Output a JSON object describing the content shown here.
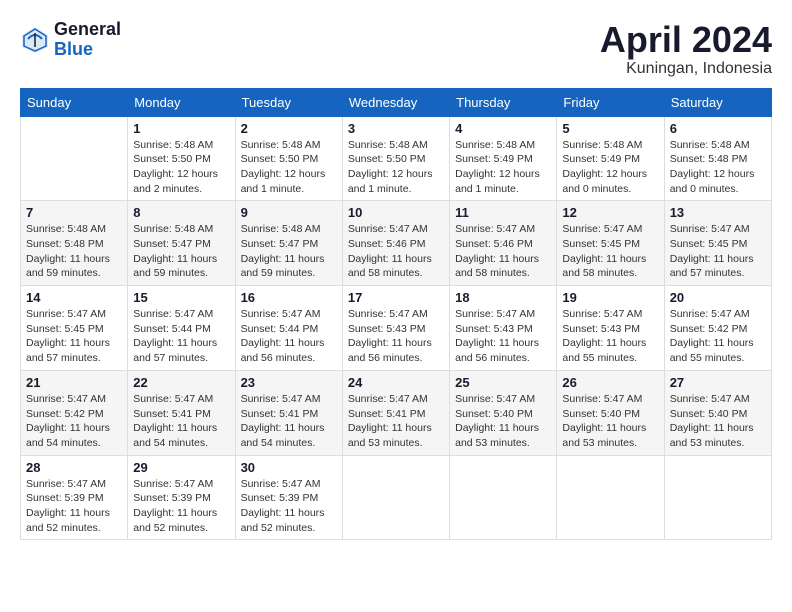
{
  "header": {
    "logo_general": "General",
    "logo_blue": "Blue",
    "month_title": "April 2024",
    "location": "Kuningan, Indonesia"
  },
  "days_of_week": [
    "Sunday",
    "Monday",
    "Tuesday",
    "Wednesday",
    "Thursday",
    "Friday",
    "Saturday"
  ],
  "weeks": [
    [
      {
        "day": "",
        "empty": true
      },
      {
        "day": "1",
        "sunrise": "Sunrise: 5:48 AM",
        "sunset": "Sunset: 5:50 PM",
        "daylight": "Daylight: 12 hours and 2 minutes."
      },
      {
        "day": "2",
        "sunrise": "Sunrise: 5:48 AM",
        "sunset": "Sunset: 5:50 PM",
        "daylight": "Daylight: 12 hours and 1 minute."
      },
      {
        "day": "3",
        "sunrise": "Sunrise: 5:48 AM",
        "sunset": "Sunset: 5:50 PM",
        "daylight": "Daylight: 12 hours and 1 minute."
      },
      {
        "day": "4",
        "sunrise": "Sunrise: 5:48 AM",
        "sunset": "Sunset: 5:49 PM",
        "daylight": "Daylight: 12 hours and 1 minute."
      },
      {
        "day": "5",
        "sunrise": "Sunrise: 5:48 AM",
        "sunset": "Sunset: 5:49 PM",
        "daylight": "Daylight: 12 hours and 0 minutes."
      },
      {
        "day": "6",
        "sunrise": "Sunrise: 5:48 AM",
        "sunset": "Sunset: 5:48 PM",
        "daylight": "Daylight: 12 hours and 0 minutes."
      }
    ],
    [
      {
        "day": "7",
        "sunrise": "Sunrise: 5:48 AM",
        "sunset": "Sunset: 5:48 PM",
        "daylight": "Daylight: 11 hours and 59 minutes."
      },
      {
        "day": "8",
        "sunrise": "Sunrise: 5:48 AM",
        "sunset": "Sunset: 5:47 PM",
        "daylight": "Daylight: 11 hours and 59 minutes."
      },
      {
        "day": "9",
        "sunrise": "Sunrise: 5:48 AM",
        "sunset": "Sunset: 5:47 PM",
        "daylight": "Daylight: 11 hours and 59 minutes."
      },
      {
        "day": "10",
        "sunrise": "Sunrise: 5:47 AM",
        "sunset": "Sunset: 5:46 PM",
        "daylight": "Daylight: 11 hours and 58 minutes."
      },
      {
        "day": "11",
        "sunrise": "Sunrise: 5:47 AM",
        "sunset": "Sunset: 5:46 PM",
        "daylight": "Daylight: 11 hours and 58 minutes."
      },
      {
        "day": "12",
        "sunrise": "Sunrise: 5:47 AM",
        "sunset": "Sunset: 5:45 PM",
        "daylight": "Daylight: 11 hours and 58 minutes."
      },
      {
        "day": "13",
        "sunrise": "Sunrise: 5:47 AM",
        "sunset": "Sunset: 5:45 PM",
        "daylight": "Daylight: 11 hours and 57 minutes."
      }
    ],
    [
      {
        "day": "14",
        "sunrise": "Sunrise: 5:47 AM",
        "sunset": "Sunset: 5:45 PM",
        "daylight": "Daylight: 11 hours and 57 minutes."
      },
      {
        "day": "15",
        "sunrise": "Sunrise: 5:47 AM",
        "sunset": "Sunset: 5:44 PM",
        "daylight": "Daylight: 11 hours and 57 minutes."
      },
      {
        "day": "16",
        "sunrise": "Sunrise: 5:47 AM",
        "sunset": "Sunset: 5:44 PM",
        "daylight": "Daylight: 11 hours and 56 minutes."
      },
      {
        "day": "17",
        "sunrise": "Sunrise: 5:47 AM",
        "sunset": "Sunset: 5:43 PM",
        "daylight": "Daylight: 11 hours and 56 minutes."
      },
      {
        "day": "18",
        "sunrise": "Sunrise: 5:47 AM",
        "sunset": "Sunset: 5:43 PM",
        "daylight": "Daylight: 11 hours and 56 minutes."
      },
      {
        "day": "19",
        "sunrise": "Sunrise: 5:47 AM",
        "sunset": "Sunset: 5:43 PM",
        "daylight": "Daylight: 11 hours and 55 minutes."
      },
      {
        "day": "20",
        "sunrise": "Sunrise: 5:47 AM",
        "sunset": "Sunset: 5:42 PM",
        "daylight": "Daylight: 11 hours and 55 minutes."
      }
    ],
    [
      {
        "day": "21",
        "sunrise": "Sunrise: 5:47 AM",
        "sunset": "Sunset: 5:42 PM",
        "daylight": "Daylight: 11 hours and 54 minutes."
      },
      {
        "day": "22",
        "sunrise": "Sunrise: 5:47 AM",
        "sunset": "Sunset: 5:41 PM",
        "daylight": "Daylight: 11 hours and 54 minutes."
      },
      {
        "day": "23",
        "sunrise": "Sunrise: 5:47 AM",
        "sunset": "Sunset: 5:41 PM",
        "daylight": "Daylight: 11 hours and 54 minutes."
      },
      {
        "day": "24",
        "sunrise": "Sunrise: 5:47 AM",
        "sunset": "Sunset: 5:41 PM",
        "daylight": "Daylight: 11 hours and 53 minutes."
      },
      {
        "day": "25",
        "sunrise": "Sunrise: 5:47 AM",
        "sunset": "Sunset: 5:40 PM",
        "daylight": "Daylight: 11 hours and 53 minutes."
      },
      {
        "day": "26",
        "sunrise": "Sunrise: 5:47 AM",
        "sunset": "Sunset: 5:40 PM",
        "daylight": "Daylight: 11 hours and 53 minutes."
      },
      {
        "day": "27",
        "sunrise": "Sunrise: 5:47 AM",
        "sunset": "Sunset: 5:40 PM",
        "daylight": "Daylight: 11 hours and 53 minutes."
      }
    ],
    [
      {
        "day": "28",
        "sunrise": "Sunrise: 5:47 AM",
        "sunset": "Sunset: 5:39 PM",
        "daylight": "Daylight: 11 hours and 52 minutes."
      },
      {
        "day": "29",
        "sunrise": "Sunrise: 5:47 AM",
        "sunset": "Sunset: 5:39 PM",
        "daylight": "Daylight: 11 hours and 52 minutes."
      },
      {
        "day": "30",
        "sunrise": "Sunrise: 5:47 AM",
        "sunset": "Sunset: 5:39 PM",
        "daylight": "Daylight: 11 hours and 52 minutes."
      },
      {
        "day": "",
        "empty": true
      },
      {
        "day": "",
        "empty": true
      },
      {
        "day": "",
        "empty": true
      },
      {
        "day": "",
        "empty": true
      }
    ]
  ]
}
